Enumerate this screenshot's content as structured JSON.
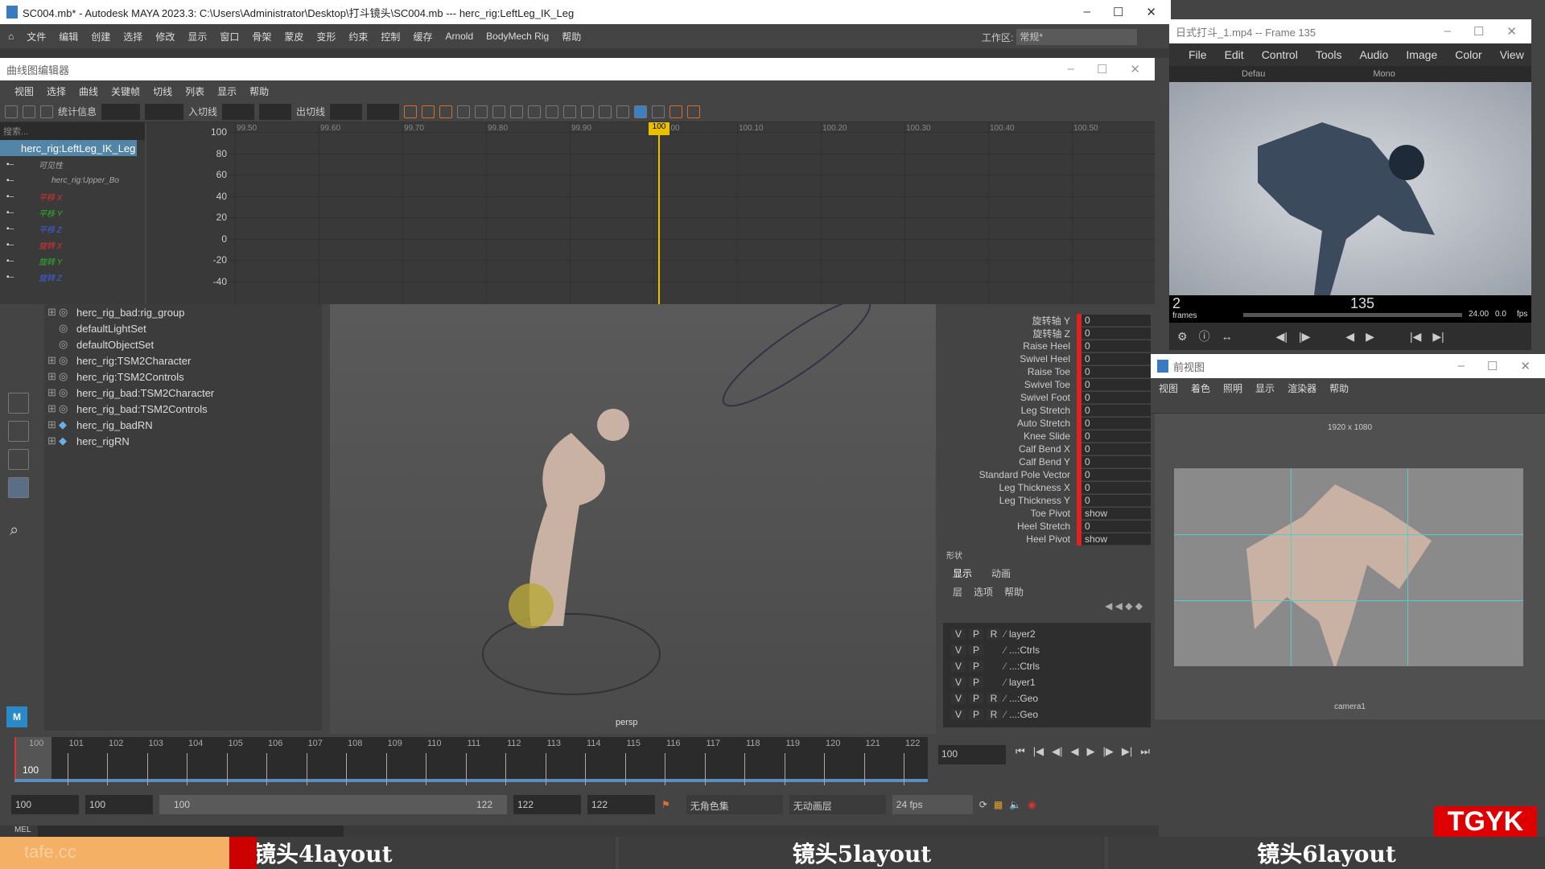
{
  "main_window": {
    "title": "SC004.mb* - Autodesk MAYA 2023.3: C:\\Users\\Administrator\\Desktop\\打斗镜头\\SC004.mb  ---  herc_rig:LeftLeg_IK_Leg",
    "menu": [
      "文件",
      "编辑",
      "创建",
      "选择",
      "修改",
      "显示",
      "窗口",
      "骨架",
      "蒙皮",
      "变形",
      "约束",
      "控制",
      "缓存",
      "Arnold",
      "BodyMech Rig",
      "帮助"
    ],
    "workspace_label": "工作区:",
    "workspace_value": "常规*"
  },
  "graph_editor": {
    "title": "曲线图编辑器",
    "menu": [
      "视图",
      "选择",
      "曲线",
      "关键帧",
      "切线",
      "列表",
      "显示",
      "帮助"
    ],
    "toolbar_labels": {
      "stats": "统计信息",
      "in_tangent": "入切线",
      "out_tangent": "出切线"
    },
    "search_placeholder": "搜索...",
    "selected_node": "herc_rig:LeftLeg_IK_Leg",
    "channels": [
      {
        "label": "可见性",
        "color": "#aaaaaa"
      },
      {
        "label": "herc_rig:Upper_Bo",
        "color": "#aaaaaa"
      },
      {
        "label": "平移 X",
        "color": "#e03030"
      },
      {
        "label": "平移 Y",
        "color": "#30b030"
      },
      {
        "label": "平移 Z",
        "color": "#4060e0"
      },
      {
        "label": "旋转 X",
        "color": "#e03030"
      },
      {
        "label": "旋转 Y",
        "color": "#30b030"
      },
      {
        "label": "旋转 Z",
        "color": "#4060e0"
      }
    ],
    "x_ticks": [
      "99.50",
      "99.60",
      "99.70",
      "99.80",
      "99.90",
      "100.00",
      "100.10",
      "100.20",
      "100.30",
      "100.40",
      "100.50"
    ],
    "y_ticks": [
      "100",
      "80",
      "60",
      "40",
      "20",
      "0",
      "-20",
      "-40"
    ],
    "current_time": "100"
  },
  "outliner": {
    "items": [
      {
        "label": "herc_rig_bad:rig_group",
        "expand": true
      },
      {
        "label": "defaultLightSet",
        "expand": false
      },
      {
        "label": "defaultObjectSet",
        "expand": false
      },
      {
        "label": "herc_rig:TSM2Character",
        "expand": true
      },
      {
        "label": "herc_rig:TSM2Controls",
        "expand": true
      },
      {
        "label": "herc_rig_bad:TSM2Character",
        "expand": true
      },
      {
        "label": "herc_rig_bad:TSM2Controls",
        "expand": true
      },
      {
        "label": "herc_rig_badRN",
        "expand": true
      },
      {
        "label": "herc_rigRN",
        "expand": true
      }
    ]
  },
  "viewport": {
    "camera": "persp"
  },
  "channel_box": {
    "rows": [
      {
        "label": "旋转轴 Y",
        "value": "0"
      },
      {
        "label": "旋转轴 Z",
        "value": "0"
      },
      {
        "label": "Raise Heel",
        "value": "0"
      },
      {
        "label": "Swivel Heel",
        "value": "0"
      },
      {
        "label": "Raise Toe",
        "value": "0"
      },
      {
        "label": "Swivel Toe",
        "value": "0"
      },
      {
        "label": "Swivel Foot",
        "value": "0"
      },
      {
        "label": "Leg Stretch",
        "value": "0"
      },
      {
        "label": "Auto Stretch",
        "value": "0"
      },
      {
        "label": "Knee Slide",
        "value": "0"
      },
      {
        "label": "Calf Bend X",
        "value": "0"
      },
      {
        "label": "Calf Bend Y",
        "value": "0"
      },
      {
        "label": "Standard Pole Vector",
        "value": "0"
      },
      {
        "label": "Leg Thickness X",
        "value": "0"
      },
      {
        "label": "Leg Thickness Y",
        "value": "0"
      },
      {
        "label": "Toe Pivot",
        "value": "show"
      },
      {
        "label": "Heel Stretch",
        "value": "0"
      },
      {
        "label": "Heel Pivot",
        "value": "show"
      }
    ],
    "section": "形状"
  },
  "layer_editor": {
    "tabs": [
      "显示",
      "动画"
    ],
    "menu": [
      "层",
      "选项",
      "帮助"
    ],
    "layers": [
      {
        "v": "V",
        "p": "P",
        "r": "R",
        "name": "layer2"
      },
      {
        "v": "V",
        "p": "P",
        "r": "",
        "name": "...:Ctrls"
      },
      {
        "v": "V",
        "p": "P",
        "r": "",
        "name": "...:Ctrls"
      },
      {
        "v": "V",
        "p": "P",
        "r": "",
        "name": "layer1"
      },
      {
        "v": "V",
        "p": "P",
        "r": "R",
        "name": "...:Geo"
      },
      {
        "v": "V",
        "p": "P",
        "r": "R",
        "name": "...:Geo"
      }
    ]
  },
  "player": {
    "title": "日式打斗_1.mp4 -- Frame 135",
    "menu": [
      "File",
      "Edit",
      "Control",
      "Tools",
      "Audio",
      "Image",
      "Color",
      "View"
    ],
    "preset": "Defau",
    "channel": "Mono",
    "frame": "135",
    "frames_left": "2",
    "frames_label": "frames",
    "fps_value": "24.00",
    "fps_extra": "0.0",
    "fps_label": "fps"
  },
  "front_view": {
    "title": "前视图",
    "menu": [
      "视图",
      "着色",
      "照明",
      "显示",
      "渲染器",
      "帮助"
    ],
    "resolution": "1920 x 1080",
    "camera": "camera1"
  },
  "timeline": {
    "ticks": [
      "100",
      "101",
      "102",
      "103",
      "104",
      "105",
      "106",
      "107",
      "108",
      "109",
      "110",
      "111",
      "112",
      "113",
      "114",
      "115",
      "116",
      "117",
      "118",
      "119",
      "120",
      "121",
      "122"
    ],
    "current": "100",
    "current_field": "100"
  },
  "range": {
    "start": "100",
    "anim_start": "100",
    "slider_start": "100",
    "slider_end": "122",
    "anim_end": "122",
    "end": "122",
    "character_set": "无角色集",
    "anim_layer": "无动画层",
    "fps": "24 fps"
  },
  "command_line": {
    "label": "MEL"
  },
  "banner": {
    "shots": [
      "镜头4layout",
      "镜头5layout",
      "镜头6layout"
    ],
    "logo": "TGYK",
    "watermark": "tafe.cc"
  }
}
